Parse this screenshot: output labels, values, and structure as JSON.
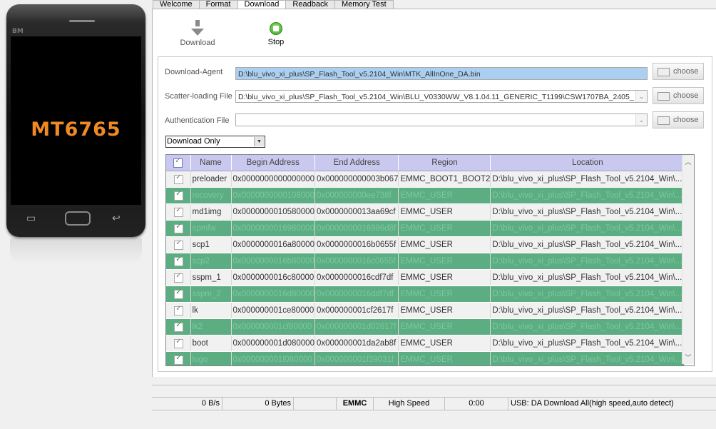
{
  "phone": {
    "brand": "BM",
    "chip": "MT6765"
  },
  "tabs": [
    "Welcome",
    "Format",
    "Download",
    "Readback",
    "Memory Test"
  ],
  "active_tab": "Download",
  "toolbar": {
    "download_label": "Download",
    "stop_label": "Stop"
  },
  "fields": {
    "download_agent": {
      "label": "Download-Agent",
      "value": "D:\\blu_vivo_xi_plus\\SP_Flash_Tool_v5.2104_Win\\MTK_AllInOne_DA.bin"
    },
    "scatter": {
      "label": "Scatter-loading File",
      "value": "D:\\blu_vivo_xi_plus\\SP_Flash_Tool_v5.2104_Win\\BLU_V0330WW_V8.1.04.11_GENERIC_T1199\\CSW1707BA_2405_"
    },
    "auth": {
      "label": "Authentication File",
      "value": ""
    }
  },
  "choose_label": "choose",
  "mode": "Download Only",
  "table": {
    "headers": [
      "Name",
      "Begin Address",
      "End Address",
      "Region",
      "Location"
    ],
    "rows": [
      [
        "preloader",
        "0x0000000000000000",
        "0x000000000003b067",
        "EMMC_BOOT1_BOOT2",
        "D:\\blu_vivo_xi_plus\\SP_Flash_Tool_v5.2104_Win\\..."
      ],
      [
        "recovery",
        "0x0000000000108000",
        "0x000000000ee738f",
        "EMMC_USER",
        "D:\\blu_vivo_xi_plus\\SP_Flash_Tool_v5.2104_Win\\..."
      ],
      [
        "md1img",
        "0x0000000010580000",
        "0x0000000013aa69cf",
        "EMMC_USER",
        "D:\\blu_vivo_xi_plus\\SP_Flash_Tool_v5.2104_Win\\..."
      ],
      [
        "spmfw",
        "0x0000000016980000",
        "0x0000000016986d8f",
        "EMMC_USER",
        "D:\\blu_vivo_xi_plus\\SP_Flash_Tool_v5.2104_Win\\..."
      ],
      [
        "scp1",
        "0x0000000016a80000",
        "0x0000000016b0655f",
        "EMMC_USER",
        "D:\\blu_vivo_xi_plus\\SP_Flash_Tool_v5.2104_Win\\..."
      ],
      [
        "scp2",
        "0x0000000016b80000",
        "0x0000000016c0655f",
        "EMMC_USER",
        "D:\\blu_vivo_xi_plus\\SP_Flash_Tool_v5.2104_Win\\..."
      ],
      [
        "sspm_1",
        "0x0000000016c80000",
        "0x0000000016cdf7df",
        "EMMC_USER",
        "D:\\blu_vivo_xi_plus\\SP_Flash_Tool_v5.2104_Win\\..."
      ],
      [
        "sspm_2",
        "0x0000000016d80000",
        "0x0000000016ddf7df",
        "EMMC_USER",
        "D:\\blu_vivo_xi_plus\\SP_Flash_Tool_v5.2104_Win\\..."
      ],
      [
        "lk",
        "0x000000001ce80000",
        "0x000000001cf2617f",
        "EMMC_USER",
        "D:\\blu_vivo_xi_plus\\SP_Flash_Tool_v5.2104_Win\\..."
      ],
      [
        "lk2",
        "0x000000001cf80000",
        "0x000000001d02617f",
        "EMMC_USER",
        "D:\\blu_vivo_xi_plus\\SP_Flash_Tool_v5.2104_Win\\..."
      ],
      [
        "boot",
        "0x000000001d080000",
        "0x000000001da2ab8f",
        "EMMC_USER",
        "D:\\blu_vivo_xi_plus\\SP_Flash_Tool_v5.2104_Win\\..."
      ],
      [
        "logo",
        "0x000000001f080000",
        "0x000000001f39031f",
        "EMMC_USER",
        "D:\\blu_vivo_xi_plus\\SP_Flash_Tool_v5.2104_Win\\..."
      ]
    ]
  },
  "status": {
    "speed": "0 B/s",
    "bytes": "0 Bytes",
    "storage": "EMMC",
    "mode": "High Speed",
    "time": "0:00",
    "usb": "USB: DA Download All(high speed,auto detect)"
  },
  "colors": {
    "row_highlight": "#5cae82",
    "header_bg": "#c9c9ef",
    "chip_text": "#f08a24"
  }
}
